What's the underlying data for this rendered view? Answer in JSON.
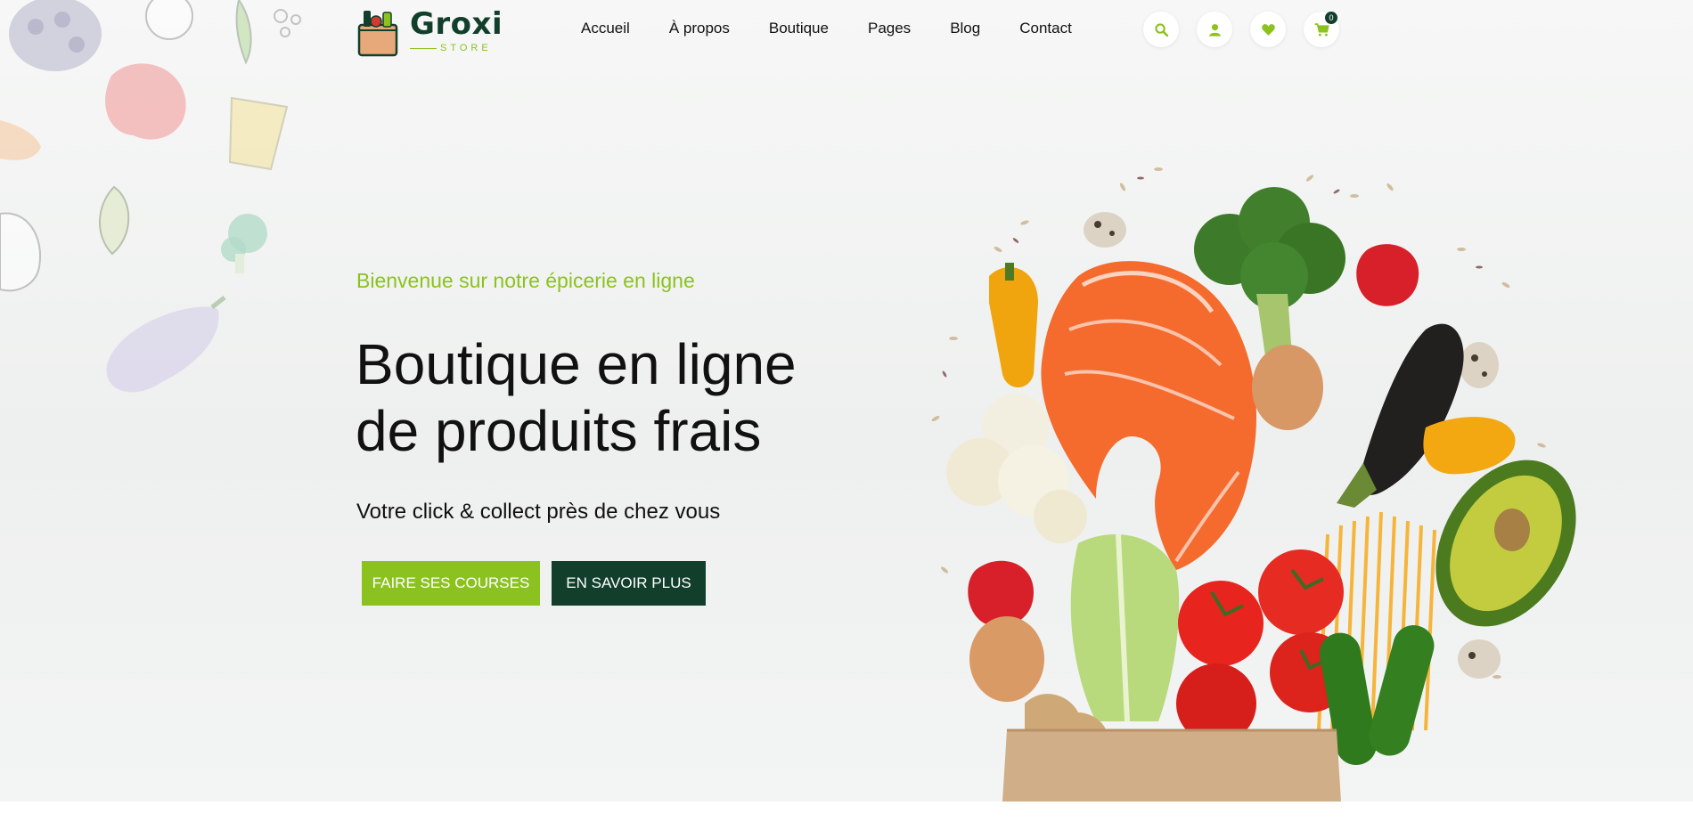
{
  "brand": {
    "name": "Groxi",
    "sub": "STORE"
  },
  "nav": {
    "items": [
      "Accueil",
      "À propos",
      "Boutique",
      "Pages",
      "Blog",
      "Contact"
    ]
  },
  "header_icons": {
    "search": "search-icon",
    "account": "user-icon",
    "wishlist": "heart-icon",
    "cart": "cart-icon",
    "cart_count": "0"
  },
  "hero": {
    "tagline": "Bienvenue sur notre épicerie en ligne",
    "headline_line1": "Boutique en ligne",
    "headline_line2": "de produits frais",
    "subline": "Votre click & collect près de chez vous",
    "primary_cta": "FAIRE SES COURSES",
    "secondary_cta": "EN SAVOIR PLUS"
  },
  "colors": {
    "accent": "#8cc21f",
    "brand_dark": "#123f2c",
    "text": "#111111"
  }
}
